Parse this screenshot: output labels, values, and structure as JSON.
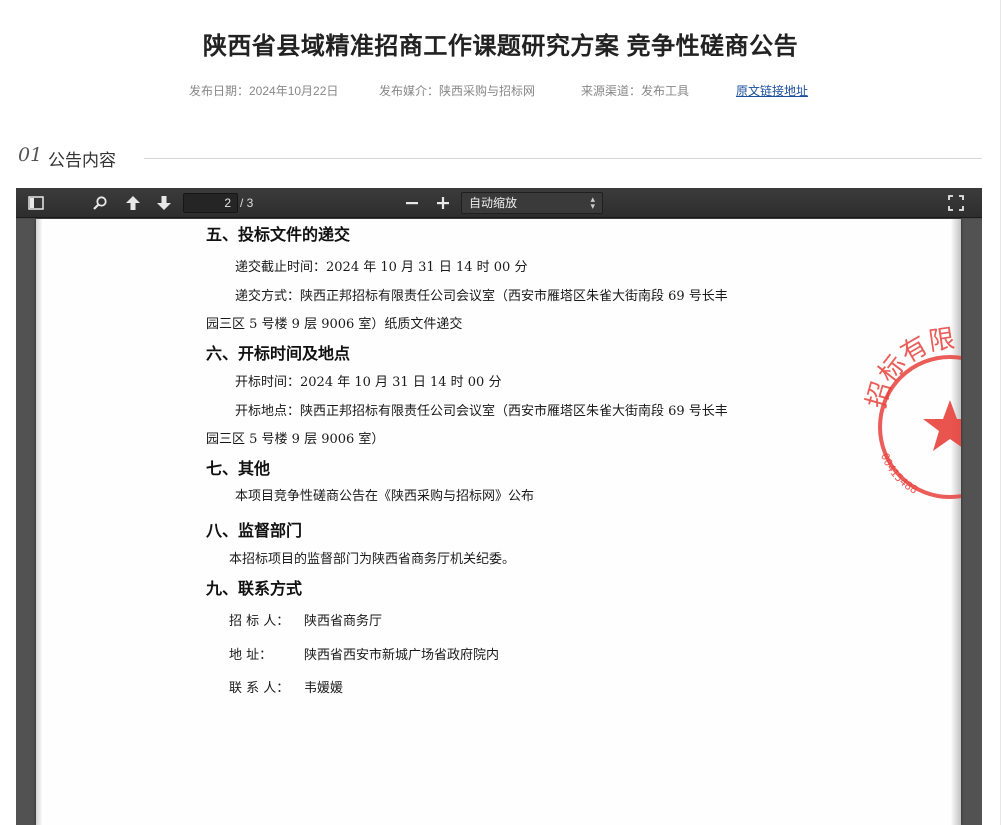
{
  "title": "陕西省县域精准招商工作课题研究方案 竞争性磋商公告",
  "meta": {
    "date": "发布日期：2024年10月22日",
    "media": "发布媒介：陕西采购与招标网",
    "source": "来源渠道：发布工具",
    "link": "原文链接地址"
  },
  "section": {
    "num": "01",
    "label": "公告内容"
  },
  "viewer": {
    "page_current": "2",
    "page_total": "/ 3",
    "zoom": "自动缩放",
    "icons": [
      "sidebar-toggle-icon",
      "search-icon",
      "arrow-up-icon",
      "arrow-down-icon",
      "minus-icon",
      "plus-icon",
      "fullscreen-icon"
    ]
  },
  "document": {
    "h5": "五、投标文件的递交",
    "p5a": "递交截止时间：2024 年 10 月 31 日  14 时 00 分",
    "p5b": "递交方式：陕西正邦招标有限责任公司会议室（西安市雁塔区朱雀大街南段 69 号长丰",
    "p5c": "园三区 5 号楼 9 层 9006 室）纸质文件递交",
    "h6": "六、开标时间及地点",
    "p6a": "开标时间：2024 年 10 月 31 日  14 时 00 分",
    "p6b": "开标地点：陕西正邦招标有限责任公司会议室（西安市雁塔区朱雀大街南段 69 号长丰",
    "p6c": "园三区 5 号楼 9 层 9006 室）",
    "h7": "七、其他",
    "p7a": "本项目竞争性磋商公告在《陕西采购与招标网》公布",
    "h8": "八、监督部门",
    "p8a": "本招标项目的监督部门为陕西省商务厅机关纪委。",
    "h9": "九、联系方式",
    "c1_label": "招  标  人：",
    "c1_value": "陕西省商务厅",
    "c2_label": "地      址：",
    "c2_value": "陕西省西安市新城广场省政府院内",
    "c3_label": "联  系  人：",
    "c3_value": "韦媛媛",
    "stamp_text": "招标有限",
    "stamp_number": "00415488"
  },
  "colors": {
    "accent_link": "#1a4f9c",
    "stamp_red": "#e8413c",
    "toolbar": "#333333"
  }
}
